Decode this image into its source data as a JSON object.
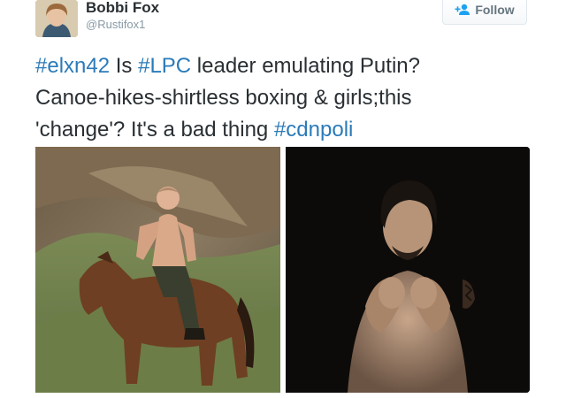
{
  "tweet": {
    "author": {
      "display_name": "Bobbi Fox",
      "handle": "@Rustifox1",
      "avatar_icon": "user-avatar-photo"
    },
    "follow_button": {
      "label": "Follow",
      "icon": "add-user-icon",
      "color": "#66757f"
    },
    "text": {
      "line1": [
        {
          "type": "hashtag",
          "text": "#elxn42"
        },
        {
          "type": "text",
          "text": " Is "
        },
        {
          "type": "hashtag",
          "text": "#LPC"
        },
        {
          "type": "text",
          "text": " leader emulating Putin?"
        }
      ],
      "line2": [
        {
          "type": "text",
          "text": "Canoe-hikes-shirtless boxing & girls;this"
        }
      ],
      "line3": [
        {
          "type": "text",
          "text": "'change'? It's a bad thing "
        },
        {
          "type": "hashtag",
          "text": "#cdnpoli"
        }
      ]
    },
    "colors": {
      "hashtag": "#2b7bb9",
      "text": "#292f33",
      "handle": "#8899a6"
    },
    "media": [
      {
        "description_icon": "photo-man-riding-horse"
      },
      {
        "description_icon": "photo-man-boxing-pose"
      }
    ]
  }
}
